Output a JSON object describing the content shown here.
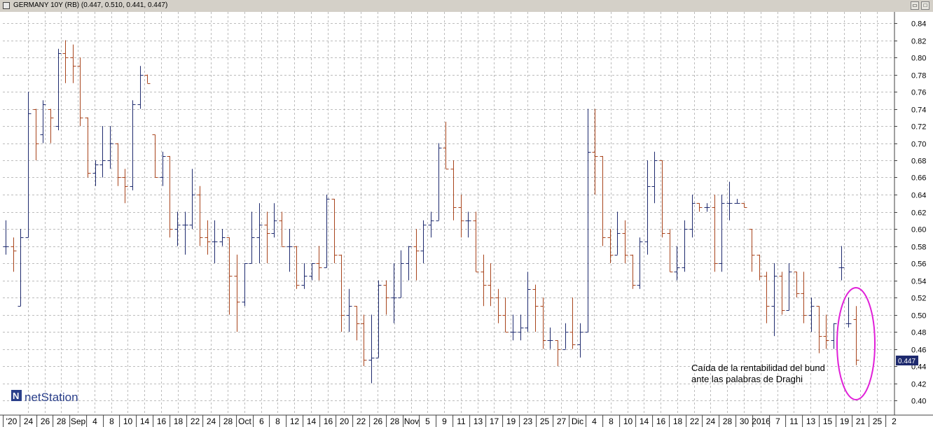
{
  "window": {
    "title": "GERMANY 10Y (RB) (0.447, 0.510, 0.441, 0.447)",
    "icon": "chart-window-icon",
    "restore_glyph": "▭",
    "maximize_glyph": "□"
  },
  "logo": {
    "mark": "N",
    "text": "netStation"
  },
  "price_tag": "0.447",
  "annotation": {
    "line1": "Caída de la rentabilidad del bund",
    "line2": "ante las palabras de Draghi"
  },
  "colors": {
    "up": "#1e2a6e",
    "down": "#a8441c",
    "ellipse": "#e020d8",
    "tag": "#1e2a6e",
    "grid": "#bcbcbc"
  },
  "chart_data": {
    "type": "ohlc_bar",
    "title": "GERMANY 10Y (RB)",
    "ylim": [
      0.385,
      0.855
    ],
    "y_ticks": [
      "0.40",
      "0.42",
      "0.44",
      "0.46",
      "0.48",
      "0.50",
      "0.52",
      "0.54",
      "0.56",
      "0.58",
      "0.60",
      "0.62",
      "0.64",
      "0.66",
      "0.68",
      "0.70",
      "0.72",
      "0.74",
      "0.76",
      "0.78",
      "0.80",
      "0.82",
      "0.84"
    ],
    "x_labels": [
      "'20",
      "24",
      "26",
      "28",
      "Sep",
      "4",
      "8",
      "10",
      "14",
      "16",
      "18",
      "22",
      "24",
      "28",
      "Oct",
      "6",
      "8",
      "12",
      "14",
      "16",
      "20",
      "22",
      "26",
      "28",
      "Nov",
      "5",
      "9",
      "11",
      "13",
      "17",
      "19",
      "23",
      "25",
      "27",
      "Dic",
      "4",
      "8",
      "10",
      "14",
      "16",
      "18",
      "22",
      "24",
      "28",
      "30",
      "2016",
      "7",
      "11",
      "13",
      "15",
      "19",
      "21",
      "25",
      "2"
    ],
    "month_labels": [
      "Sep",
      "Oct",
      "Nov",
      "Dic",
      "2016"
    ],
    "last": {
      "open": 0.447,
      "high": 0.51,
      "low": 0.441,
      "close": 0.447
    },
    "ohlc": [
      [
        0.58,
        0.61,
        0.57,
        0.58
      ],
      [
        0.58,
        0.59,
        0.55,
        0.575
      ],
      [
        0.51,
        0.6,
        0.51,
        0.59
      ],
      [
        0.59,
        0.76,
        0.59,
        0.735
      ],
      [
        0.74,
        0.74,
        0.68,
        0.7
      ],
      [
        0.71,
        0.75,
        0.7,
        0.745
      ],
      [
        0.74,
        0.74,
        0.7,
        0.73
      ],
      [
        0.72,
        0.81,
        0.715,
        0.805
      ],
      [
        0.805,
        0.82,
        0.77,
        0.8
      ],
      [
        0.8,
        0.815,
        0.77,
        0.79
      ],
      [
        0.79,
        0.8,
        0.72,
        0.73
      ],
      [
        0.73,
        0.71,
        0.66,
        0.665
      ],
      [
        0.665,
        0.68,
        0.65,
        0.675
      ],
      [
        0.675,
        0.72,
        0.66,
        0.68
      ],
      [
        0.68,
        0.72,
        0.67,
        0.7
      ],
      [
        0.7,
        0.69,
        0.65,
        0.66
      ],
      [
        0.66,
        0.67,
        0.63,
        0.65
      ],
      [
        0.65,
        0.75,
        0.645,
        0.745
      ],
      [
        0.745,
        0.79,
        0.74,
        0.78
      ],
      [
        0.78,
        0.78,
        0.77,
        0.77
      ],
      [
        0.71,
        0.71,
        0.66,
        0.66
      ],
      [
        0.66,
        0.69,
        0.65,
        0.685
      ],
      [
        0.685,
        0.68,
        0.59,
        0.6
      ],
      [
        0.6,
        0.62,
        0.58,
        0.605
      ],
      [
        0.605,
        0.62,
        0.57,
        0.605
      ],
      [
        0.605,
        0.67,
        0.6,
        0.64
      ],
      [
        0.64,
        0.65,
        0.58,
        0.59
      ],
      [
        0.59,
        0.61,
        0.57,
        0.585
      ],
      [
        0.585,
        0.61,
        0.56,
        0.585
      ],
      [
        0.585,
        0.6,
        0.58,
        0.59
      ],
      [
        0.59,
        0.58,
        0.5,
        0.545
      ],
      [
        0.545,
        0.57,
        0.48,
        0.515
      ],
      [
        0.515,
        0.56,
        0.51,
        0.56
      ],
      [
        0.56,
        0.62,
        0.56,
        0.59
      ],
      [
        0.59,
        0.63,
        0.56,
        0.605
      ],
      [
        0.605,
        0.62,
        0.56,
        0.595
      ],
      [
        0.595,
        0.63,
        0.59,
        0.61
      ],
      [
        0.61,
        0.62,
        0.58,
        0.58
      ],
      [
        0.58,
        0.6,
        0.55,
        0.58
      ],
      [
        0.58,
        0.57,
        0.53,
        0.535
      ],
      [
        0.535,
        0.56,
        0.53,
        0.545
      ],
      [
        0.545,
        0.56,
        0.54,
        0.56
      ],
      [
        0.56,
        0.58,
        0.54,
        0.555
      ],
      [
        0.555,
        0.64,
        0.555,
        0.635
      ],
      [
        0.635,
        0.63,
        0.56,
        0.57
      ],
      [
        0.57,
        0.56,
        0.48,
        0.5
      ],
      [
        0.5,
        0.53,
        0.48,
        0.51
      ],
      [
        0.51,
        0.5,
        0.47,
        0.49
      ],
      [
        0.49,
        0.5,
        0.44,
        0.447
      ],
      [
        0.447,
        0.5,
        0.42,
        0.45
      ],
      [
        0.45,
        0.54,
        0.45,
        0.535
      ],
      [
        0.535,
        0.54,
        0.5,
        0.52
      ],
      [
        0.52,
        0.56,
        0.49,
        0.52
      ],
      [
        0.52,
        0.575,
        0.52,
        0.56
      ],
      [
        0.56,
        0.58,
        0.54,
        0.58
      ],
      [
        0.58,
        0.6,
        0.54,
        0.575
      ],
      [
        0.575,
        0.61,
        0.56,
        0.605
      ],
      [
        0.605,
        0.62,
        0.59,
        0.61
      ],
      [
        0.61,
        0.7,
        0.61,
        0.695
      ],
      [
        0.695,
        0.725,
        0.67,
        0.67
      ],
      [
        0.67,
        0.68,
        0.61,
        0.625
      ],
      [
        0.625,
        0.64,
        0.59,
        0.61
      ],
      [
        0.61,
        0.62,
        0.59,
        0.61
      ],
      [
        0.61,
        0.62,
        0.57,
        0.55
      ],
      [
        0.55,
        0.57,
        0.51,
        0.535
      ],
      [
        0.535,
        0.56,
        0.51,
        0.52
      ],
      [
        0.52,
        0.53,
        0.49,
        0.5
      ],
      [
        0.5,
        0.52,
        0.48,
        0.48
      ],
      [
        0.48,
        0.5,
        0.47,
        0.48
      ],
      [
        0.48,
        0.5,
        0.47,
        0.485
      ],
      [
        0.485,
        0.55,
        0.48,
        0.53
      ],
      [
        0.53,
        0.535,
        0.48,
        0.51
      ],
      [
        0.51,
        0.52,
        0.46,
        0.47
      ],
      [
        0.47,
        0.485,
        0.46,
        0.47
      ],
      [
        0.47,
        0.47,
        0.44,
        0.46
      ],
      [
        0.46,
        0.49,
        0.46,
        0.48
      ],
      [
        0.48,
        0.52,
        0.46,
        0.465
      ],
      [
        0.465,
        0.49,
        0.45,
        0.48
      ],
      [
        0.48,
        0.74,
        0.48,
        0.69
      ],
      [
        0.69,
        0.74,
        0.64,
        0.685
      ],
      [
        0.685,
        0.68,
        0.58,
        0.59
      ],
      [
        0.59,
        0.6,
        0.56,
        0.57
      ],
      [
        0.57,
        0.62,
        0.57,
        0.595
      ],
      [
        0.595,
        0.61,
        0.56,
        0.57
      ],
      [
        0.57,
        0.56,
        0.53,
        0.535
      ],
      [
        0.535,
        0.59,
        0.53,
        0.585
      ],
      [
        0.585,
        0.68,
        0.57,
        0.65
      ],
      [
        0.65,
        0.69,
        0.63,
        0.68
      ],
      [
        0.68,
        0.66,
        0.59,
        0.595
      ],
      [
        0.595,
        0.6,
        0.55,
        0.55
      ],
      [
        0.55,
        0.58,
        0.54,
        0.555
      ],
      [
        0.555,
        0.61,
        0.55,
        0.6
      ],
      [
        0.6,
        0.64,
        0.59,
        0.63
      ],
      [
        0.63,
        0.63,
        0.62,
        0.625
      ],
      [
        0.625,
        0.63,
        0.62,
        0.625
      ],
      [
        0.625,
        0.64,
        0.55,
        0.56
      ],
      [
        0.56,
        0.64,
        0.55,
        0.63
      ],
      [
        0.63,
        0.655,
        0.61,
        0.63
      ],
      [
        0.63,
        0.635,
        0.63,
        0.63
      ],
      [
        0.63,
        0.63,
        0.625,
        0.625
      ],
      [
        0.6,
        0.6,
        0.55,
        0.57
      ],
      [
        0.57,
        0.55,
        0.54,
        0.545
      ],
      [
        0.545,
        0.55,
        0.49,
        0.51
      ],
      [
        0.51,
        0.56,
        0.475,
        0.545
      ],
      [
        0.545,
        0.55,
        0.5,
        0.505
      ],
      [
        0.505,
        0.56,
        0.505,
        0.55
      ],
      [
        0.55,
        0.55,
        0.52,
        0.525
      ],
      [
        0.525,
        0.55,
        0.49,
        0.5
      ],
      [
        0.5,
        0.52,
        0.48,
        0.51
      ],
      [
        0.51,
        0.5,
        0.455,
        0.475
      ],
      [
        0.475,
        0.5,
        0.46,
        0.47
      ],
      [
        0.47,
        0.46,
        0.46,
        0.49
      ],
      [
        0.555,
        0.58,
        0.54,
        0.555
      ],
      [
        0.49,
        0.52,
        0.485,
        0.49
      ],
      [
        0.495,
        0.51,
        0.441,
        0.447
      ]
    ]
  }
}
